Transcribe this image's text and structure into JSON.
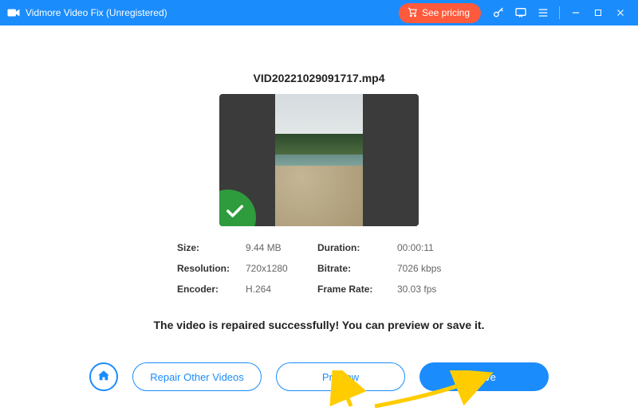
{
  "window": {
    "title": "Vidmore Video Fix (Unregistered)"
  },
  "titlebar": {
    "see_pricing": "See pricing"
  },
  "file": {
    "name": "VID20221029091717.mp4"
  },
  "meta": {
    "size_label": "Size:",
    "size": "9.44 MB",
    "duration_label": "Duration:",
    "duration": "00:00:11",
    "resolution_label": "Resolution:",
    "resolution": "720x1280",
    "bitrate_label": "Bitrate:",
    "bitrate": "7026 kbps",
    "encoder_label": "Encoder:",
    "encoder": "H.264",
    "framerate_label": "Frame Rate:",
    "framerate": "30.03 fps"
  },
  "status_message": "The video is repaired successfully! You can preview or save it.",
  "buttons": {
    "repair_other": "Repair Other Videos",
    "preview": "Preview",
    "save": "Save"
  }
}
